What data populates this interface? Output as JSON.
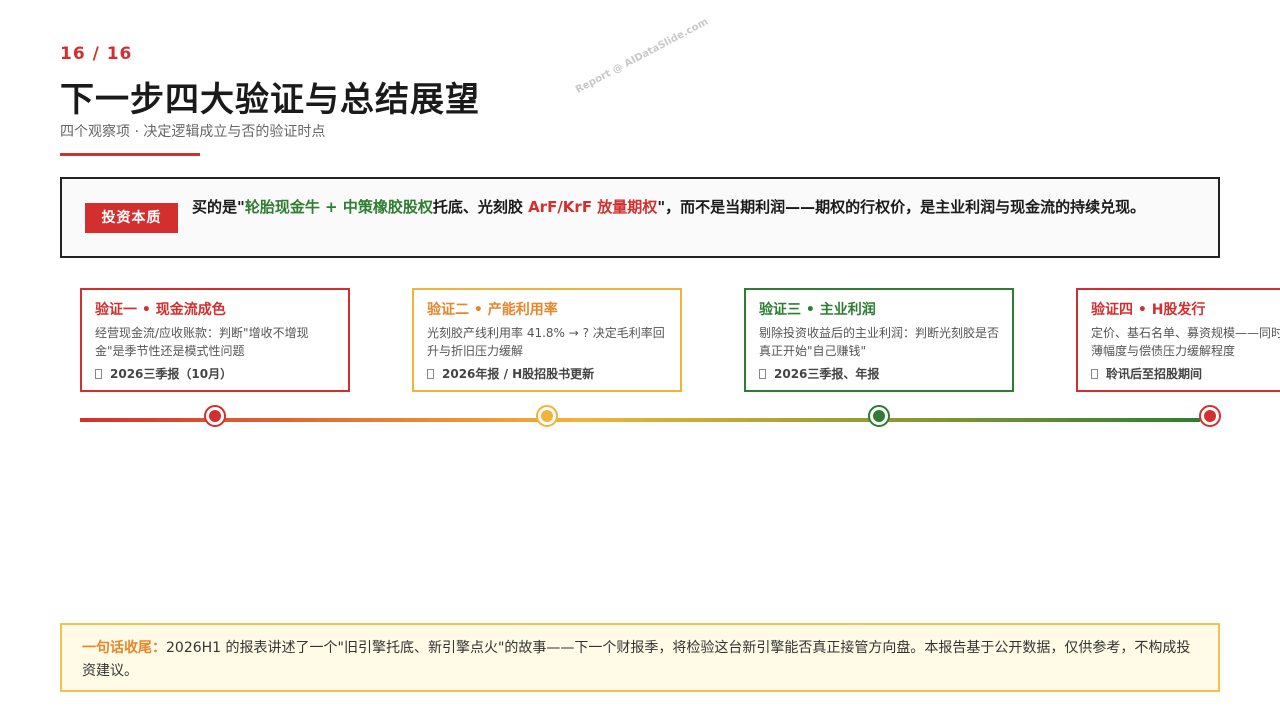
{
  "header": {
    "page_number": "16 / 16",
    "title": "下一步四大验证与总结展望",
    "subtitle": "四个观察项 · 决定逻辑成立与否的验证时点"
  },
  "watermark": "Report @ AIDataSlide.com",
  "essence": {
    "badge": "投资本质",
    "parts": {
      "p1": "买的是\"",
      "p2": "轮胎现金牛 + 中策橡胶股权",
      "p3": "托底、光刻胶 ",
      "p4": "ArF/KrF 放量期权",
      "p5": "\"，而不是当期利润——期权的行权价，是主业利润与现金流的持续兑现。"
    }
  },
  "cards": [
    {
      "title": "验证一 • 现金流成色",
      "body": "经营现金流/应收账款：判断\"增收不增现金\"是季节性还是模式性问题",
      "time": "2026三季报（10月）"
    },
    {
      "title": "验证二 • 产能利用率",
      "body": "光刻胶产线利用率 41.8% → ? 决定毛利率回升与折旧压力缓解",
      "time": "2026年报 / H股招股书更新"
    },
    {
      "title": "验证三 • 主业利润",
      "body": "剔除投资收益后的主业利润：判断光刻胶是否真正开始\"自己赚钱\"",
      "time": "2026三季报、年报"
    },
    {
      "title": "验证四 • H股发行",
      "body_line1": "定价、基石名单、募资规模——同时",
      "body_line2": "薄幅度与偿债压力缓解程度",
      "time": "聆讯后至招股期间"
    }
  ],
  "colors": {
    "accent_red": "#d32f2f",
    "accent_orange": "#e8862c",
    "accent_yellow": "#f0b43a",
    "accent_green": "#2e7d32"
  },
  "summary": {
    "label": "一句话收尾：",
    "text": "2026H1 的报表讲述了一个\"旧引擎托底、新引擎点火\"的故事——下一个财报季，将检验这台新引擎能否真正接管方向盘。本报告基于公开数据，仅供参考，不构成投资建议。"
  }
}
